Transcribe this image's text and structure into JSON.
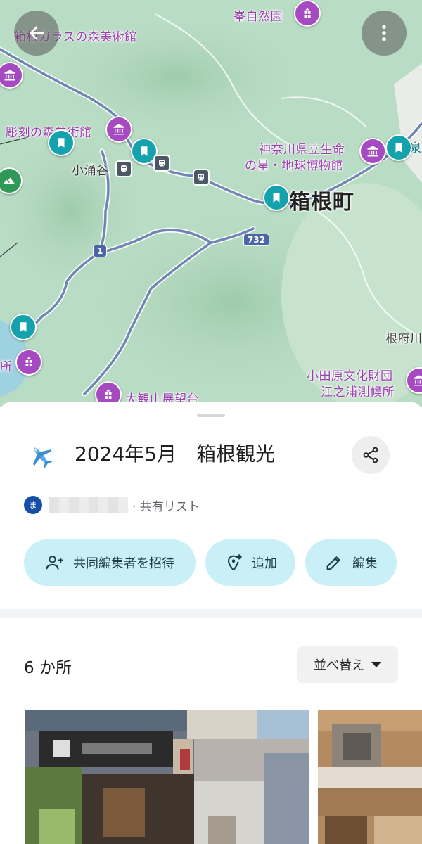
{
  "map": {
    "labels": {
      "glass_museum": "箱根ガラスの森美術館",
      "mine_garden": "峯自然園",
      "sculpture_museum": "彫刻の森美術館",
      "kowakidani": "小涌谷",
      "kanagawa_museum_line1": "神奈川県立生命",
      "kanagawa_museum_line2": "の星・地球博物館",
      "hakone_town": "箱根町",
      "negabu": "根府川",
      "odawara_line1": "小田原文化財団",
      "odawara_line2": "江之浦測候所",
      "observatory": "大観山展望台",
      "partial_left": "所",
      "partial_right": "泉林"
    },
    "route_1": "1",
    "route_732": "732",
    "colors": {
      "water": "#9fd2e0",
      "land": "#b9dcc4",
      "road": "#6f86b3",
      "museum_pin": "#a64ac1",
      "saved_pin": "#14a3ad"
    }
  },
  "header": {
    "back_icon": "back-arrow-icon",
    "more_icon": "more-vert-icon"
  },
  "list": {
    "emoji": "✈️",
    "title": "2024年5月　箱根観光",
    "owner_initial": "ま",
    "owner_meta": "· 共有リスト",
    "actions": [
      {
        "label": "共同編集者を招待",
        "icon": "person-add-icon"
      },
      {
        "label": "追加",
        "icon": "add-location-icon"
      },
      {
        "label": "編集",
        "icon": "pencil-icon"
      }
    ],
    "count": "6 か所",
    "sort_label": "並べ替え"
  }
}
